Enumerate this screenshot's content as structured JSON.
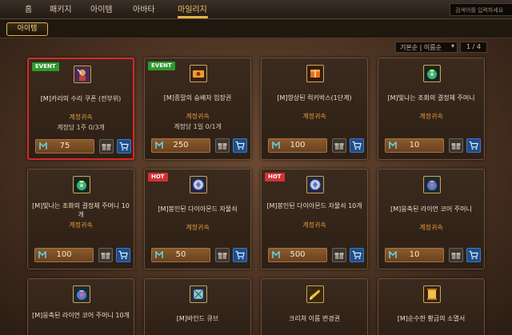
{
  "nav": {
    "items": [
      {
        "label": "홈"
      },
      {
        "label": "패키지"
      },
      {
        "label": "아이템"
      },
      {
        "label": "아바타"
      },
      {
        "label": "마일리지"
      }
    ],
    "active_index": 4,
    "search_placeholder": "검색어를 입력하세요"
  },
  "subnav": {
    "active_tab": "아이템"
  },
  "sort": {
    "selected": "기본순 | 이름순",
    "page": "1 / 4"
  },
  "cards": [
    {
      "badge": "EVENT",
      "badge_type": "event",
      "name": "[M]카리의 수리 쿠폰 (전부위)",
      "bind": "계정귀속",
      "limit": "계정당 1주 0/3개",
      "price": "75",
      "icon": "repair-coupon-icon",
      "selected": true
    },
    {
      "badge": "EVENT",
      "badge_type": "event",
      "name": "[M]종말의 숭배자 입장권",
      "bind": "계정귀속",
      "limit": "계정당 1일 0/1개",
      "price": "250",
      "icon": "ticket-icon",
      "selected": false
    },
    {
      "badge": "",
      "badge_type": "",
      "name": "[M]향상된 럭키박스(1단계)",
      "bind": "계정귀속",
      "limit": "",
      "price": "100",
      "icon": "lucky-box-icon",
      "selected": false
    },
    {
      "badge": "",
      "badge_type": "",
      "name": "[M]빛나는 조화의 결정체 주머니",
      "bind": "계정귀속",
      "limit": "",
      "price": "10",
      "icon": "crystal-pouch-icon",
      "selected": false
    },
    {
      "badge": "",
      "badge_type": "",
      "name": "[M]빛나는 조화의 결정체 주머니 10개",
      "bind": "계정귀속",
      "limit": "",
      "price": "100",
      "icon": "crystal-pouch-icon",
      "selected": false
    },
    {
      "badge": "HOT",
      "badge_type": "hot",
      "name": "[M]봉인된 다이아몬드 자물쇠",
      "bind": "계정귀속",
      "limit": "",
      "price": "50",
      "icon": "diamond-lock-icon",
      "selected": false
    },
    {
      "badge": "HOT",
      "badge_type": "hot",
      "name": "[M]봉인된 다이아몬드 자물쇠 10개",
      "bind": "계정귀속",
      "limit": "",
      "price": "500",
      "icon": "diamond-lock-icon",
      "selected": false
    },
    {
      "badge": "",
      "badge_type": "",
      "name": "[M]응축된 라이언 코어 주머니",
      "bind": "계정귀속",
      "limit": "",
      "price": "10",
      "icon": "lion-core-pouch-icon",
      "selected": false
    },
    {
      "badge": "",
      "badge_type": "",
      "name": "[M]응축된 라이언 코어 주머니 10개",
      "bind": "",
      "limit": "",
      "price": "",
      "icon": "lion-core-pouch-icon",
      "selected": false
    },
    {
      "badge": "",
      "badge_type": "",
      "name": "[M]바인드 큐브",
      "bind": "",
      "limit": "",
      "price": "",
      "icon": "bind-cube-icon",
      "selected": false
    },
    {
      "badge": "",
      "badge_type": "",
      "name": "크리쳐 이름 변경권",
      "bind": "",
      "limit": "",
      "price": "",
      "icon": "rename-ticket-icon",
      "selected": false
    },
    {
      "badge": "",
      "badge_type": "",
      "name": "[M]순수한 황금의 소멸서",
      "bind": "",
      "limit": "",
      "price": "",
      "icon": "golden-scroll-icon",
      "selected": false
    }
  ],
  "colors": {
    "accent": "#e4b449",
    "bind_text": "#e39a3c",
    "event_badge": "#2f9a2f",
    "hot_badge": "#d23232",
    "cart_button": "#1e4d87",
    "selected_border": "#d42a2a"
  }
}
